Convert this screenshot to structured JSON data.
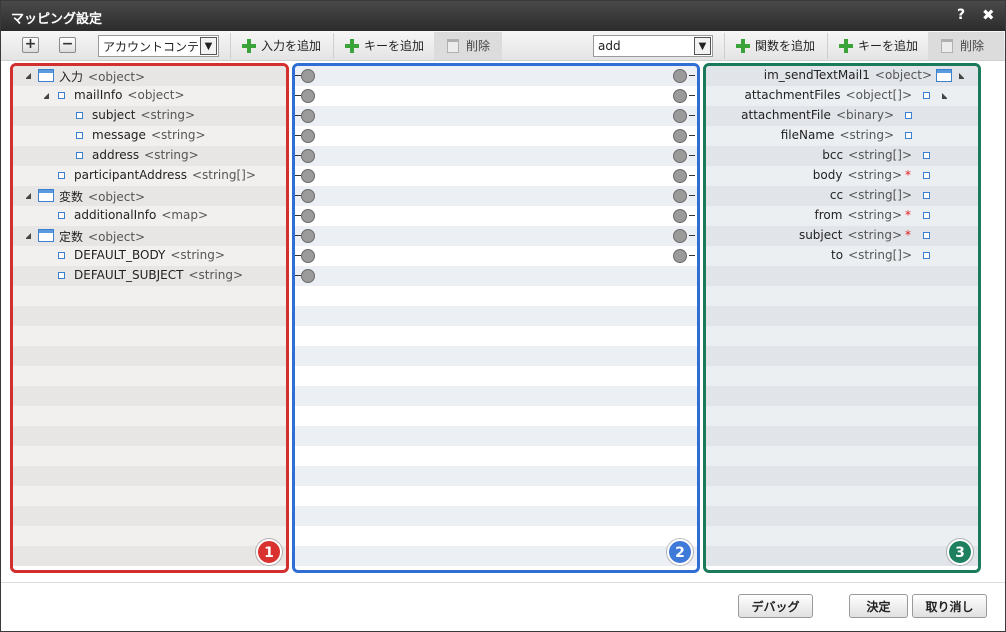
{
  "window": {
    "title": "マッピング設定",
    "help_label": "?",
    "close_label": "✖"
  },
  "toolbar": {
    "expand_label": "+",
    "collapse_label": "−",
    "left_select_value": "アカウントコンテ",
    "add_input_label": "入力を追加",
    "add_key_label": "キーを追加",
    "delete_label": "削除",
    "mid_select_value": "add",
    "add_function_label": "関数を追加",
    "right_add_key_label": "キーを追加",
    "right_delete_label": "削除"
  },
  "left_panel": {
    "badge": "1",
    "rows": [
      {
        "name": "入力",
        "type": "<object>",
        "level": 0,
        "toggle": true,
        "icon": "object-icon"
      },
      {
        "name": "mailInfo",
        "type": "<object>",
        "level": 1,
        "toggle": true,
        "icon": "square-icon"
      },
      {
        "name": "subject",
        "type": "<string>",
        "level": 2,
        "toggle": false,
        "icon": "square-icon"
      },
      {
        "name": "message",
        "type": "<string>",
        "level": 2,
        "toggle": false,
        "icon": "square-icon"
      },
      {
        "name": "address",
        "type": "<string>",
        "level": 2,
        "toggle": false,
        "icon": "square-icon"
      },
      {
        "name": "participantAddress",
        "type": "<string[]>",
        "level": 1,
        "toggle": false,
        "icon": "square-icon"
      },
      {
        "name": "変数",
        "type": "<object>",
        "level": 0,
        "toggle": true,
        "icon": "object-icon"
      },
      {
        "name": "additionalInfo",
        "type": "<map>",
        "level": 1,
        "toggle": false,
        "icon": "square-icon"
      },
      {
        "name": "定数",
        "type": "<object>",
        "level": 0,
        "toggle": true,
        "icon": "object-icon"
      },
      {
        "name": "DEFAULT_BODY",
        "type": "<string>",
        "level": 1,
        "toggle": false,
        "icon": "square-icon"
      },
      {
        "name": "DEFAULT_SUBJECT",
        "type": "<string>",
        "level": 1,
        "toggle": false,
        "icon": "square-icon"
      }
    ]
  },
  "mid_panel": {
    "badge": "2",
    "left_ports": 11,
    "right_ports": 10
  },
  "right_panel": {
    "badge": "3",
    "rows": [
      {
        "name": "im_sendTextMail1",
        "type": "<object>",
        "required": false,
        "icon": "object-icon",
        "toggle": true
      },
      {
        "name": "attachmentFiles",
        "type": "<object[]>",
        "required": false,
        "icon": "square-icon",
        "toggle": true
      },
      {
        "name": "attachmentFile",
        "type": "<binary>",
        "required": false,
        "icon": "square-icon",
        "toggle": false
      },
      {
        "name": "fileName",
        "type": "<string>",
        "required": false,
        "icon": "square-icon",
        "toggle": false
      },
      {
        "name": "bcc",
        "type": "<string[]>",
        "required": false,
        "icon": "square-icon",
        "toggle": false
      },
      {
        "name": "body",
        "type": "<string>",
        "required": true,
        "icon": "square-icon",
        "toggle": false
      },
      {
        "name": "cc",
        "type": "<string[]>",
        "required": false,
        "icon": "square-icon",
        "toggle": false
      },
      {
        "name": "from",
        "type": "<string>",
        "required": true,
        "icon": "square-icon",
        "toggle": false
      },
      {
        "name": "subject",
        "type": "<string>",
        "required": true,
        "icon": "square-icon",
        "toggle": false
      },
      {
        "name": "to",
        "type": "<string[]>",
        "required": false,
        "icon": "square-icon",
        "toggle": false
      }
    ]
  },
  "footer": {
    "debug_label": "デバッグ",
    "ok_label": "決定",
    "cancel_label": "取り消し"
  },
  "colors": {
    "left_border": "#d32f2f",
    "mid_border": "#2f6fd3",
    "right_border": "#1b7a5a"
  }
}
